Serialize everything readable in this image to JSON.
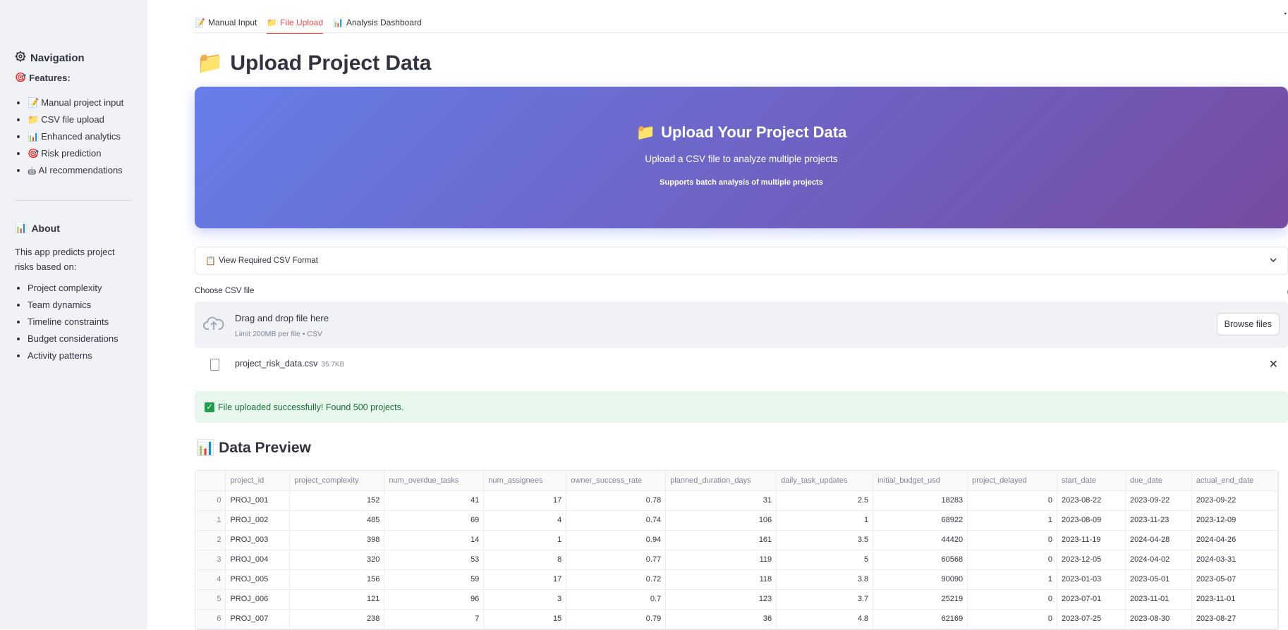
{
  "sidebar": {
    "nav_icon": "gear-icon",
    "nav_heading": "Navigation",
    "features_label": "Features:",
    "features": [
      {
        "icon": "📝",
        "label": "Manual project input"
      },
      {
        "icon": "📁",
        "label": "CSV file upload"
      },
      {
        "icon": "📊",
        "label": "Enhanced analytics"
      },
      {
        "icon": "🎯",
        "label": "Risk prediction"
      },
      {
        "icon": "🤖",
        "label": "AI recommendations"
      }
    ],
    "about_heading": "About",
    "about_text": "This app predicts project risks based on:",
    "about_items": [
      "Project complexity",
      "Team dynamics",
      "Timeline constraints",
      "Budget considerations",
      "Activity patterns"
    ]
  },
  "tabs": [
    {
      "icon": "📝",
      "label": "Manual Input",
      "active": false
    },
    {
      "icon": "📁",
      "label": "File Upload",
      "active": true
    },
    {
      "icon": "📊",
      "label": "Analysis Dashboard",
      "active": false
    }
  ],
  "page_title": "Upload Project Data",
  "hero": {
    "title": "Upload Your Project Data",
    "subtitle": "Upload a CSV file to analyze multiple projects",
    "note": "Supports batch analysis of multiple projects",
    "gradient_start": "#667eea",
    "gradient_end": "#764ba2"
  },
  "expander_label": "View Required CSV Format",
  "uploader": {
    "label": "Choose CSV file",
    "drop_title": "Drag and drop file here",
    "drop_sub": "Limit 200MB per file • CSV",
    "browse_label": "Browse files",
    "file_name": "project_risk_data.csv",
    "file_size": "35.7KB"
  },
  "success_message": "File uploaded successfully! Found 500 projects.",
  "preview_title": "Data Preview",
  "table": {
    "columns": [
      "project_id",
      "project_complexity",
      "num_overdue_tasks",
      "num_assignees",
      "owner_success_rate",
      "planned_duration_days",
      "daily_task_updates",
      "initial_budget_usd",
      "project_delayed",
      "start_date",
      "due_date",
      "actual_end_date"
    ],
    "rows": [
      [
        "0",
        "PROJ_001",
        "152",
        "41",
        "17",
        "0.78",
        "31",
        "2.5",
        "18283",
        "0",
        "2023-08-22",
        "2023-09-22",
        "2023-09-22"
      ],
      [
        "1",
        "PROJ_002",
        "485",
        "69",
        "4",
        "0.74",
        "106",
        "1",
        "68922",
        "1",
        "2023-08-09",
        "2023-11-23",
        "2023-12-09"
      ],
      [
        "2",
        "PROJ_003",
        "398",
        "14",
        "1",
        "0.94",
        "161",
        "3.5",
        "44420",
        "0",
        "2023-11-19",
        "2024-04-28",
        "2024-04-26"
      ],
      [
        "3",
        "PROJ_004",
        "320",
        "53",
        "8",
        "0.77",
        "119",
        "5",
        "60568",
        "0",
        "2023-12-05",
        "2024-04-02",
        "2024-03-31"
      ],
      [
        "4",
        "PROJ_005",
        "156",
        "59",
        "17",
        "0.72",
        "118",
        "3.8",
        "90090",
        "1",
        "2023-01-03",
        "2023-05-01",
        "2023-05-07"
      ],
      [
        "5",
        "PROJ_006",
        "121",
        "96",
        "3",
        "0.7",
        "123",
        "3.7",
        "25219",
        "0",
        "2023-07-01",
        "2023-11-01",
        "2023-11-01"
      ],
      [
        "6",
        "PROJ_007",
        "238",
        "7",
        "15",
        "0.79",
        "36",
        "4.8",
        "62169",
        "0",
        "2023-07-25",
        "2023-08-30",
        "2023-08-27"
      ]
    ]
  }
}
